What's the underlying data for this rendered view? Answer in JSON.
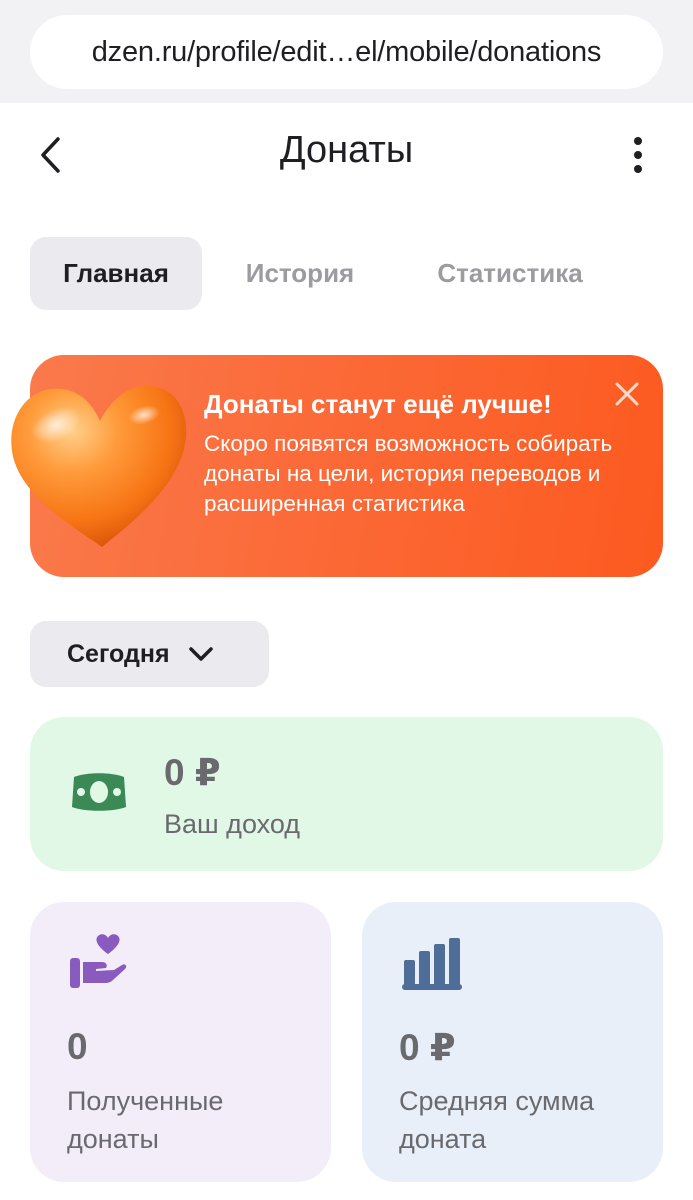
{
  "browser": {
    "url": "dzen.ru/profile/edit…el/mobile/donations"
  },
  "header": {
    "title": "Донаты"
  },
  "tabs": [
    {
      "label": "Главная",
      "active": true
    },
    {
      "label": "История",
      "active": false
    },
    {
      "label": "Статистика",
      "active": false
    }
  ],
  "banner": {
    "title": "Донаты станут ещё лучше!",
    "text": "Скоро появятся возможность собирать донаты на цели, история переводов и расширенная статистика",
    "color": "#fc5a1f"
  },
  "period": {
    "label": "Сегодня"
  },
  "income": {
    "amount": "0 ₽",
    "label": "Ваш доход",
    "color": "#3b8a55"
  },
  "received": {
    "value": "0",
    "label": "Полученные донаты",
    "color": "#8a5bbf"
  },
  "average": {
    "value": "0 ₽",
    "label": "Средняя сумма доната",
    "color": "#4f6d99"
  }
}
